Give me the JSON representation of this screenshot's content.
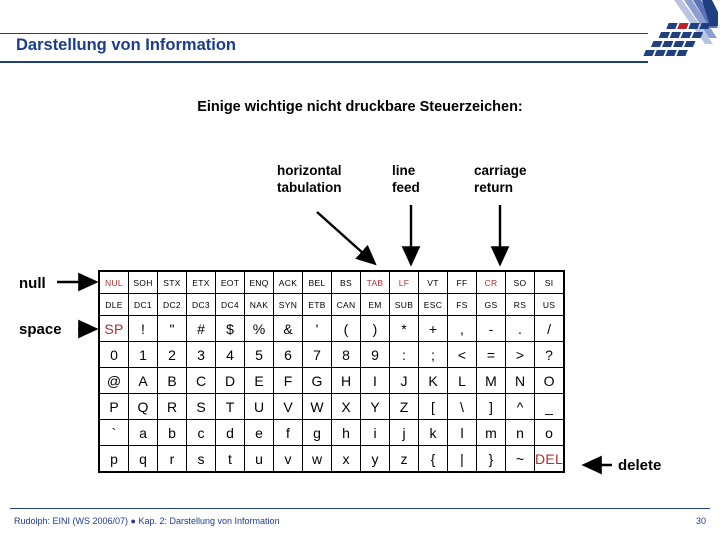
{
  "slide": {
    "title": "Darstellung von Information",
    "subtitle": "Einige wichtige nicht druckbare Steuerzeichen:",
    "accent_color": "#1b3c8c",
    "highlight_color": "#b03030"
  },
  "callouts": {
    "tab": "horizontal\ntabulation",
    "tab_line1": "horizontal",
    "tab_line2": "tabulation",
    "lf_line1": "line",
    "lf_line2": "feed",
    "cr_line1": "carriage",
    "cr_line2": "return"
  },
  "side_labels": {
    "null": "null",
    "space": "space",
    "delete": "delete"
  },
  "ascii_table": {
    "rows": [
      {
        "kind": "control",
        "cells": [
          {
            "t": "NUL",
            "red": true
          },
          {
            "t": "SOH",
            "red": false
          },
          {
            "t": "STX",
            "red": false
          },
          {
            "t": "ETX",
            "red": false
          },
          {
            "t": "EOT",
            "red": false
          },
          {
            "t": "ENQ",
            "red": false
          },
          {
            "t": "ACK",
            "red": false
          },
          {
            "t": "BEL",
            "red": false
          },
          {
            "t": "BS",
            "red": false
          },
          {
            "t": "TAB",
            "red": true
          },
          {
            "t": "LF",
            "red": true
          },
          {
            "t": "VT",
            "red": false
          },
          {
            "t": "FF",
            "red": false
          },
          {
            "t": "CR",
            "red": true
          },
          {
            "t": "SO",
            "red": false
          },
          {
            "t": "SI",
            "red": false
          }
        ]
      },
      {
        "kind": "control",
        "cells": [
          {
            "t": "DLE",
            "red": false
          },
          {
            "t": "DC1",
            "red": false
          },
          {
            "t": "DC2",
            "red": false
          },
          {
            "t": "DC3",
            "red": false
          },
          {
            "t": "DC4",
            "red": false
          },
          {
            "t": "NAK",
            "red": false
          },
          {
            "t": "SYN",
            "red": false
          },
          {
            "t": "ETB",
            "red": false
          },
          {
            "t": "CAN",
            "red": false
          },
          {
            "t": "EM",
            "red": false
          },
          {
            "t": "SUB",
            "red": false
          },
          {
            "t": "ESC",
            "red": false
          },
          {
            "t": "FS",
            "red": false
          },
          {
            "t": "GS",
            "red": false
          },
          {
            "t": "RS",
            "red": false
          },
          {
            "t": "US",
            "red": false
          }
        ]
      },
      {
        "kind": "glyph",
        "cells": [
          {
            "t": "SP",
            "red": true,
            "small": true
          },
          {
            "t": "!",
            "red": false
          },
          {
            "t": "\"",
            "red": false
          },
          {
            "t": "#",
            "red": false
          },
          {
            "t": "$",
            "red": false
          },
          {
            "t": "%",
            "red": false
          },
          {
            "t": "&",
            "red": false
          },
          {
            "t": "'",
            "red": false
          },
          {
            "t": "(",
            "red": false
          },
          {
            "t": ")",
            "red": false
          },
          {
            "t": "*",
            "red": false
          },
          {
            "t": "+",
            "red": false
          },
          {
            "t": ",",
            "red": false
          },
          {
            "t": "-",
            "red": false
          },
          {
            "t": ".",
            "red": false
          },
          {
            "t": "/",
            "red": false
          }
        ]
      },
      {
        "kind": "glyph",
        "cells": [
          {
            "t": "0",
            "red": false
          },
          {
            "t": "1",
            "red": false
          },
          {
            "t": "2",
            "red": false
          },
          {
            "t": "3",
            "red": false
          },
          {
            "t": "4",
            "red": false
          },
          {
            "t": "5",
            "red": false
          },
          {
            "t": "6",
            "red": false
          },
          {
            "t": "7",
            "red": false
          },
          {
            "t": "8",
            "red": false
          },
          {
            "t": "9",
            "red": false
          },
          {
            "t": ":",
            "red": false
          },
          {
            "t": ";",
            "red": false
          },
          {
            "t": "<",
            "red": false
          },
          {
            "t": "=",
            "red": false
          },
          {
            "t": ">",
            "red": false
          },
          {
            "t": "?",
            "red": false
          }
        ]
      },
      {
        "kind": "glyph",
        "cells": [
          {
            "t": "@",
            "red": false
          },
          {
            "t": "A",
            "red": false
          },
          {
            "t": "B",
            "red": false
          },
          {
            "t": "C",
            "red": false
          },
          {
            "t": "D",
            "red": false
          },
          {
            "t": "E",
            "red": false
          },
          {
            "t": "F",
            "red": false
          },
          {
            "t": "G",
            "red": false
          },
          {
            "t": "H",
            "red": false
          },
          {
            "t": "I",
            "red": false
          },
          {
            "t": "J",
            "red": false
          },
          {
            "t": "K",
            "red": false
          },
          {
            "t": "L",
            "red": false
          },
          {
            "t": "M",
            "red": false
          },
          {
            "t": "N",
            "red": false
          },
          {
            "t": "O",
            "red": false
          }
        ]
      },
      {
        "kind": "glyph",
        "cells": [
          {
            "t": "P",
            "red": false
          },
          {
            "t": "Q",
            "red": false
          },
          {
            "t": "R",
            "red": false
          },
          {
            "t": "S",
            "red": false
          },
          {
            "t": "T",
            "red": false
          },
          {
            "t": "U",
            "red": false
          },
          {
            "t": "V",
            "red": false
          },
          {
            "t": "W",
            "red": false
          },
          {
            "t": "X",
            "red": false
          },
          {
            "t": "Y",
            "red": false
          },
          {
            "t": "Z",
            "red": false
          },
          {
            "t": "[",
            "red": false
          },
          {
            "t": "\\",
            "red": false
          },
          {
            "t": "]",
            "red": false
          },
          {
            "t": "^",
            "red": false
          },
          {
            "t": "_",
            "red": false
          }
        ]
      },
      {
        "kind": "glyph",
        "cells": [
          {
            "t": "`",
            "red": false
          },
          {
            "t": "a",
            "red": false
          },
          {
            "t": "b",
            "red": false
          },
          {
            "t": "c",
            "red": false
          },
          {
            "t": "d",
            "red": false
          },
          {
            "t": "e",
            "red": false
          },
          {
            "t": "f",
            "red": false
          },
          {
            "t": "g",
            "red": false
          },
          {
            "t": "h",
            "red": false
          },
          {
            "t": "i",
            "red": false
          },
          {
            "t": "j",
            "red": false
          },
          {
            "t": "k",
            "red": false
          },
          {
            "t": "l",
            "red": false
          },
          {
            "t": "m",
            "red": false
          },
          {
            "t": "n",
            "red": false
          },
          {
            "t": "o",
            "red": false
          }
        ]
      },
      {
        "kind": "glyph",
        "cells": [
          {
            "t": "p",
            "red": false
          },
          {
            "t": "q",
            "red": false
          },
          {
            "t": "r",
            "red": false
          },
          {
            "t": "s",
            "red": false
          },
          {
            "t": "t",
            "red": false
          },
          {
            "t": "u",
            "red": false
          },
          {
            "t": "v",
            "red": false
          },
          {
            "t": "w",
            "red": false
          },
          {
            "t": "x",
            "red": false
          },
          {
            "t": "y",
            "red": false
          },
          {
            "t": "z",
            "red": false
          },
          {
            "t": "{",
            "red": false
          },
          {
            "t": "|",
            "red": false
          },
          {
            "t": "}",
            "red": false
          },
          {
            "t": "~",
            "red": false
          },
          {
            "t": "DEL",
            "red": true,
            "small": true
          }
        ]
      }
    ]
  },
  "footer": {
    "text": "Rudolph: EINI (WS 2006/07)  ●  Kap. 2: Darstellung von Information",
    "page": "30"
  }
}
